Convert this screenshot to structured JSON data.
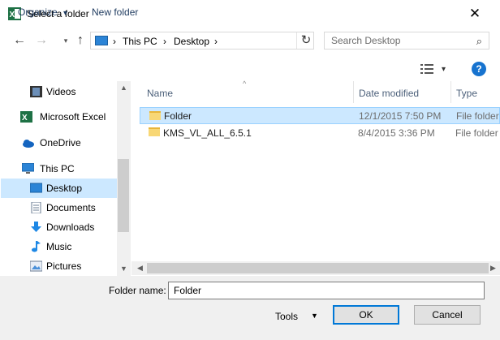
{
  "window": {
    "title": "Select a folder",
    "close_glyph": "✕"
  },
  "nav": {
    "back": "←",
    "forward": "→",
    "up": "↑",
    "refresh": "↻"
  },
  "address": {
    "seg1": "This PC",
    "seg2": "Desktop",
    "sep": "›"
  },
  "search": {
    "placeholder": "Search Desktop",
    "icon": "⌕"
  },
  "toolbar": {
    "organize": "Organize",
    "new_folder": "New folder",
    "help": "?",
    "dropdown": "▾"
  },
  "nav_pane": {
    "items": [
      {
        "label": "Videos",
        "icon": "film-icon"
      },
      {
        "label": "Microsoft Excel",
        "icon": "excel-icon"
      },
      {
        "label": "OneDrive",
        "icon": "cloud-icon"
      },
      {
        "label": "This PC",
        "icon": "computer-icon"
      },
      {
        "label": "Desktop",
        "icon": "desktop-icon",
        "selected": true
      },
      {
        "label": "Documents",
        "icon": "document-icon"
      },
      {
        "label": "Downloads",
        "icon": "download-icon"
      },
      {
        "label": "Music",
        "icon": "music-icon"
      },
      {
        "label": "Pictures",
        "icon": "picture-icon"
      }
    ]
  },
  "columns": {
    "name": "Name",
    "date": "Date modified",
    "type": "Type"
  },
  "files": [
    {
      "name": "Folder",
      "date": "12/1/2015 7:50 PM",
      "type": "File folder",
      "selected": true
    },
    {
      "name": "KMS_VL_ALL_6.5.1",
      "date": "8/4/2015 3:36 PM",
      "type": "File folder"
    }
  ],
  "footer": {
    "folder_name_label": "Folder name:",
    "folder_name_value": "Folder",
    "tools": "Tools",
    "tools_arrow": "▼",
    "ok": "OK",
    "cancel": "Cancel"
  },
  "colors": {
    "accent": "#0078d7",
    "selection": "#cce8ff",
    "excel_green": "#1e7145"
  }
}
